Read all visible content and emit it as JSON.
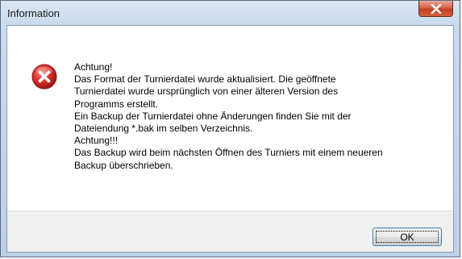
{
  "window": {
    "title": "Information",
    "close_icon": "close-icon"
  },
  "dialog": {
    "icon": "error-icon",
    "message_lines": [
      "Achtung!",
      "Das Format der Turnierdatei wurde aktualisiert. Die geöffnete",
      "Turnierdatei wurde ursprünglich von einer älteren Version des",
      "Programms erstellt.",
      "Ein Backup der Turnierdatei ohne Änderungen finden Sie mit der",
      "Dateiendung *.bak im selben Verzeichnis.",
      "Achtung!!!",
      "Das Backup wird beim nächsten Öffnen des Turniers mit einem neueren",
      "Backup überschrieben."
    ],
    "ok_label": "OK"
  },
  "colors": {
    "error_red": "#c8262a",
    "close_red": "#c2401f"
  }
}
